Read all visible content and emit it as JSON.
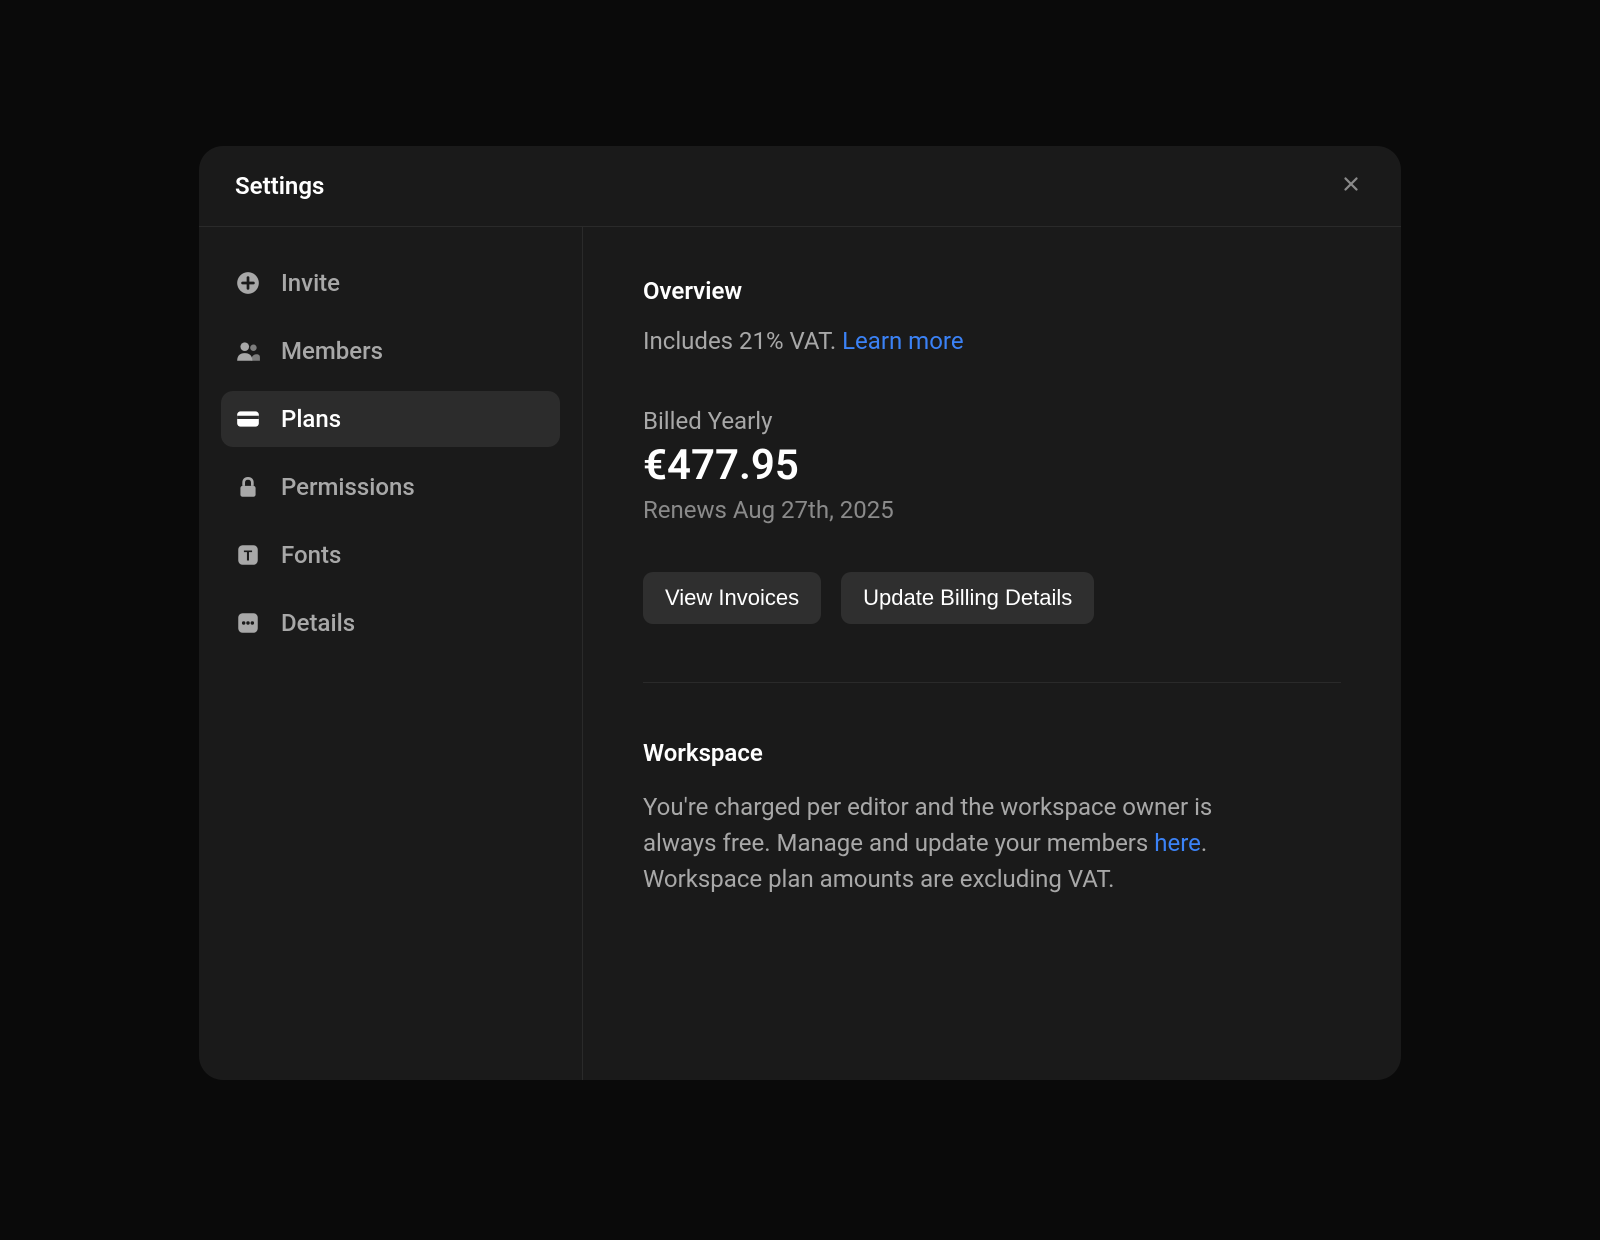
{
  "modal": {
    "title": "Settings"
  },
  "sidebar": {
    "items": [
      {
        "label": "Invite"
      },
      {
        "label": "Members"
      },
      {
        "label": "Plans"
      },
      {
        "label": "Permissions"
      },
      {
        "label": "Fonts"
      },
      {
        "label": "Details"
      }
    ]
  },
  "overview": {
    "title": "Overview",
    "vat_text": "Includes 21% VAT. ",
    "learn_more": "Learn more",
    "billed_label": "Billed Yearly",
    "price": "€477.95",
    "renews": "Renews Aug 27th, 2025",
    "view_invoices": "View Invoices",
    "update_billing": "Update Billing Details"
  },
  "workspace": {
    "title": "Workspace",
    "desc_part1": "You're charged per editor and the workspace owner is always free. Manage and update your members ",
    "here_link": "here",
    "desc_part2": ". Workspace plan amounts are excluding VAT."
  }
}
